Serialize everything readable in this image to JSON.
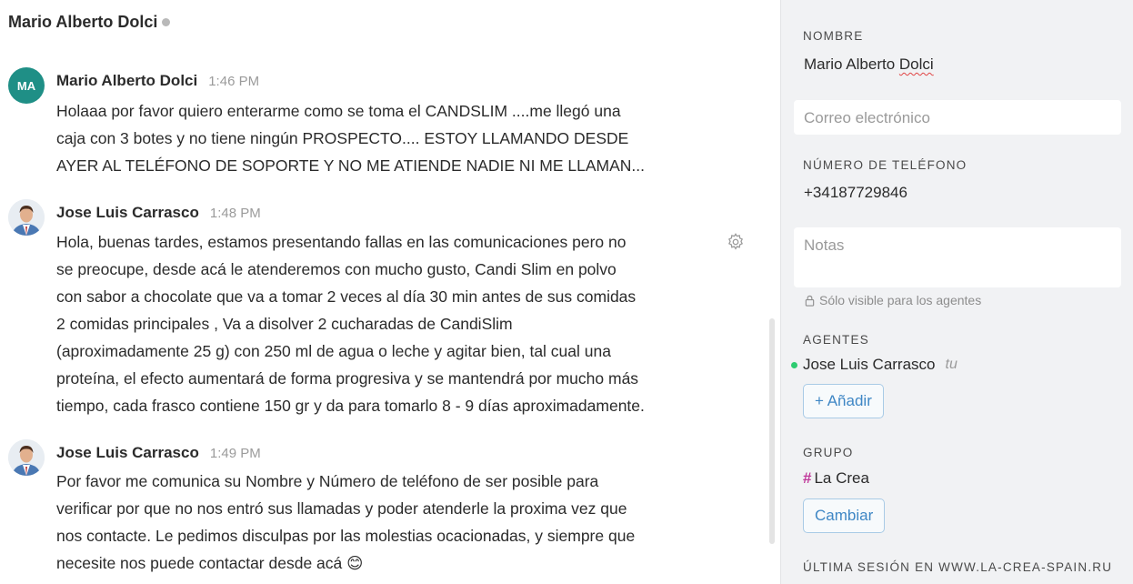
{
  "chat": {
    "contact_name": "Mario Alberto Dolci",
    "messages": [
      {
        "author": "Mario Alberto Dolci",
        "initials": "MA",
        "time": "1:46 PM",
        "lines": [
          "Holaaa por favor quiero enterarme como se toma el CANDSLIM ....me llegó una",
          "caja con 3 botes y no tiene ningún PROSPECTO.... ESTOY LLAMANDO DESDE",
          "AYER AL TELÉFONO DE SOPORTE Y NO ME ATIENDE NADIE NI ME LLAMAN..."
        ]
      },
      {
        "author": "Jose Luis Carrasco",
        "time": "1:48 PM",
        "lines": [
          "Hola, buenas tardes, estamos presentando fallas en las comunicaciones pero no",
          "se preocupe, desde acá le atenderemos con mucho gusto, Candi Slim en polvo",
          "con sabor a chocolate que va a tomar 2 veces al día 30 min antes de sus comidas",
          "2 comidas principales , Va a disolver 2 cucharadas de CandiSlim",
          "(aproximadamente 25 g) con 250 ml de agua o leche y agitar bien, tal cual una",
          "proteína, el efecto aumentará de forma progresiva y se mantendrá por mucho más",
          "tiempo, cada frasco contiene 150 gr y da para tomarlo 8 - 9 días aproximadamente."
        ]
      },
      {
        "author": "Jose Luis Carrasco",
        "time": "1:49 PM",
        "lines": [
          "Por favor me comunica su Nombre y Número de teléfono de ser posible para",
          "verificar por que no nos entró sus llamadas y poder atenderle la proxima vez que",
          "nos contacte. Le pedimos disculpas por las molestias ocacionadas, y siempre que",
          "necesite nos puede contactar desde acá"
        ],
        "emoji": "😊"
      }
    ]
  },
  "sidebar": {
    "name_label": "NOMBRE",
    "name_value": "Mario Alberto Dolci",
    "name_first": "Mario Alberto ",
    "name_last": "Dolci",
    "email_placeholder": "Correo electrónico",
    "phone_label": "NÚMERO DE TELÉFONO",
    "phone_value": "+34187729846",
    "notes_placeholder": "Notas",
    "notes_hint": "Sólo visible para los agentes",
    "agents_label": "AGENTES",
    "agent_name": "Jose Luis Carrasco",
    "agent_you": "tu",
    "add_agent_label": "+ Añadir",
    "group_label": "GRUPO",
    "group_hash": "#",
    "group_name": "La Crea",
    "change_group_label": "Cambiar",
    "last_session_label": "ÚLTIMA SESIÓN EN WWW.LA-CREA-SPAIN.RU"
  },
  "icons": {
    "status": "status-dot-icon",
    "gear": "gear-icon",
    "lock": "lock-icon",
    "online": "online-dot-icon"
  },
  "colors": {
    "avatar_initials_bg": "#1f8f86",
    "accent_blue": "#3f87c5",
    "group_hash": "#c0399a",
    "online": "#2ecc71",
    "sidebar_bg": "#f1f2f4"
  }
}
